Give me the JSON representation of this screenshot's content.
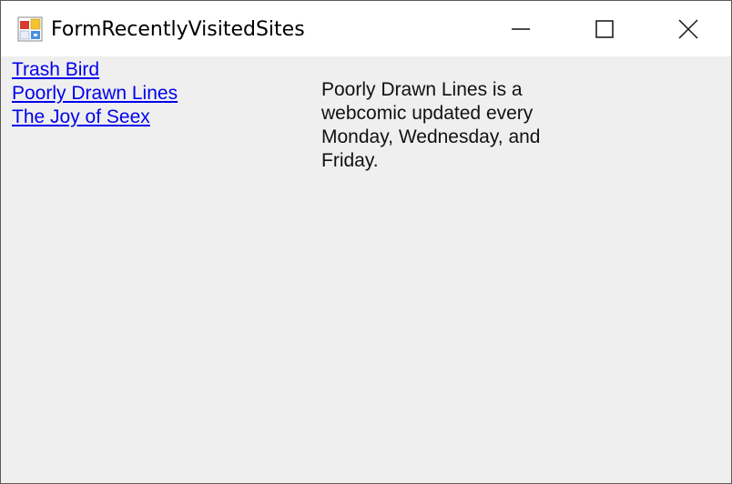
{
  "window": {
    "title": "FormRecentlyVisitedSites",
    "icon": "windows-form-app-icon",
    "controls": {
      "minimize": "minimize-icon",
      "maximize": "maximize-icon",
      "close": "close-icon"
    }
  },
  "links": [
    {
      "label": "Trash Bird"
    },
    {
      "label": "Poorly Drawn Lines"
    },
    {
      "label": "The Joy of Seex"
    }
  ],
  "description": "Poorly Drawn Lines is a webcomic updated every Monday, Wednesday, and Friday.",
  "colors": {
    "link": "#0000ee",
    "client_background": "#efefef",
    "titlebar_background": "#ffffff"
  }
}
